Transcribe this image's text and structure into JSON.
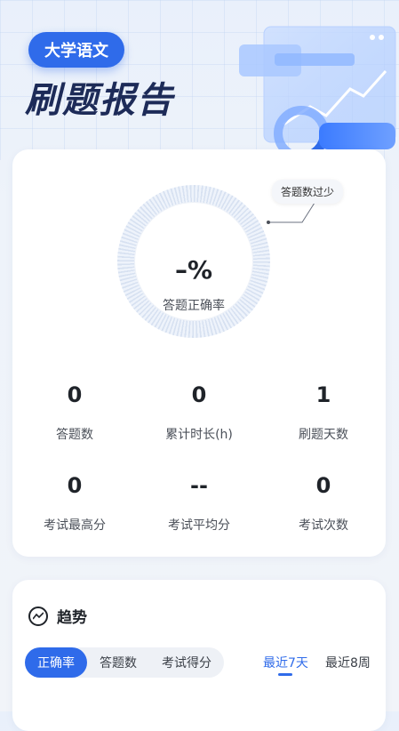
{
  "header": {
    "subject": "大学语文",
    "title": "刷题报告"
  },
  "summary": {
    "accuracy_value": "–%",
    "accuracy_label": "答题正确率",
    "notice": "答题数过少",
    "stats": [
      {
        "value": "0",
        "label": "答题数"
      },
      {
        "value": "0",
        "label": "累计时长(h)"
      },
      {
        "value": "1",
        "label": "刷题天数"
      },
      {
        "value": "0",
        "label": "考试最高分"
      },
      {
        "value": "--",
        "label": "考试平均分"
      },
      {
        "value": "0",
        "label": "考试次数"
      }
    ]
  },
  "trend": {
    "title": "趋势",
    "tabs": [
      "正确率",
      "答题数",
      "考试得分"
    ],
    "active_tab": "正确率",
    "ranges": [
      "最近7天",
      "最近8周"
    ],
    "active_range": "最近7天"
  },
  "colors": {
    "accent": "#2f6bea",
    "title_dark": "#1d2b58",
    "ring": "#d7e1f1"
  }
}
